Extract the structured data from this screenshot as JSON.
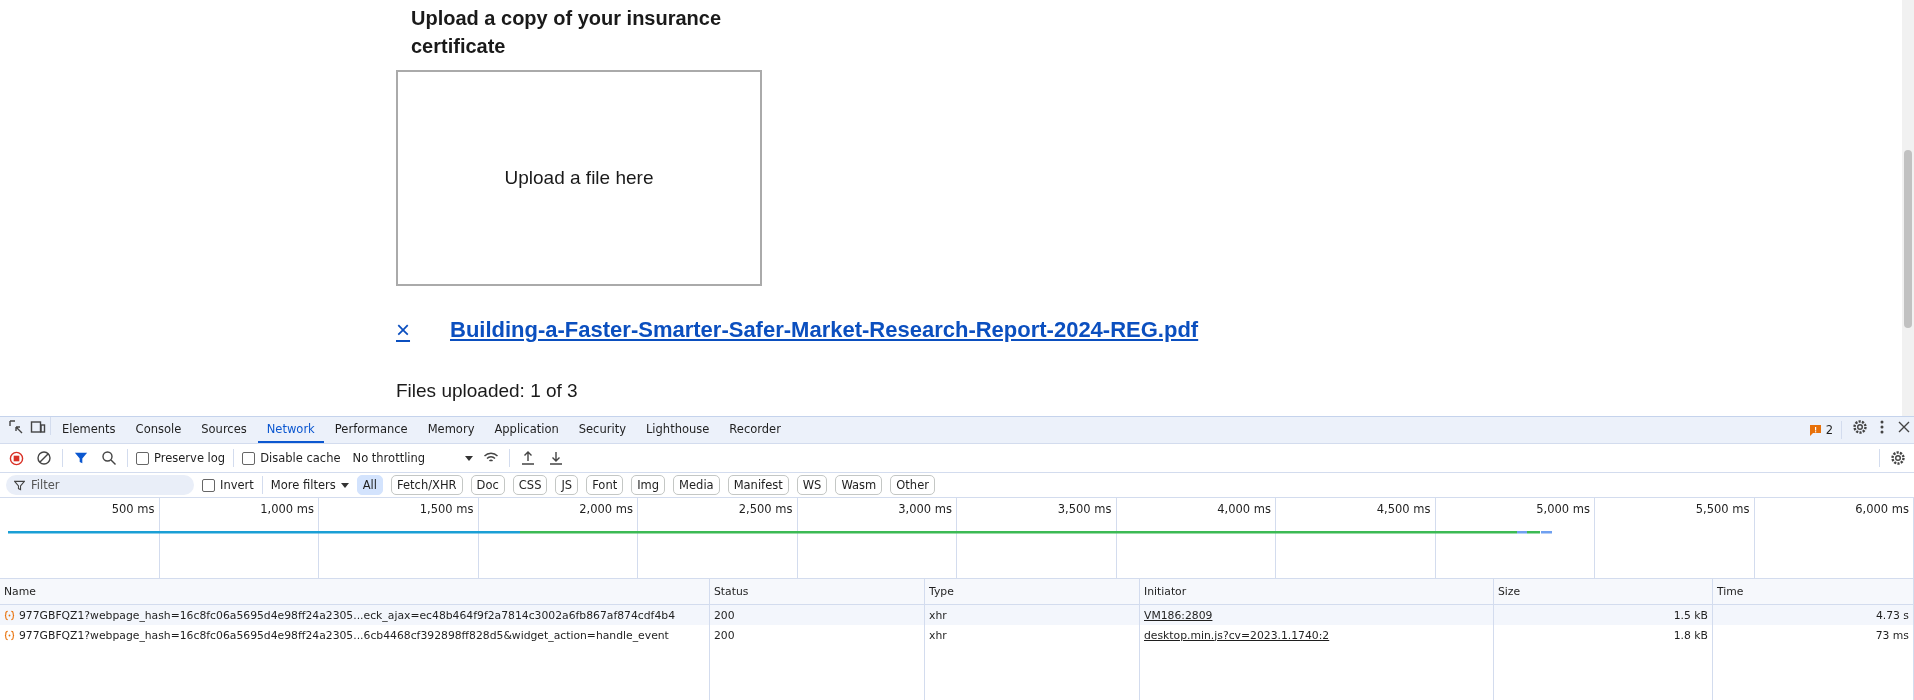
{
  "page": {
    "heading": "Upload a copy of your insurance certificate",
    "dropzone": "Upload a file here",
    "remove_symbol": "×",
    "file_link": "Building-a-Faster-Smarter-Safer-Market-Research-Report-2024-REG.pdf",
    "status": "Files uploaded: 1 of 3"
  },
  "devtools": {
    "tabs": [
      {
        "label": "Elements",
        "selected": false
      },
      {
        "label": "Console",
        "selected": false
      },
      {
        "label": "Sources",
        "selected": false
      },
      {
        "label": "Network",
        "selected": true
      },
      {
        "label": "Performance",
        "selected": false
      },
      {
        "label": "Memory",
        "selected": false
      },
      {
        "label": "Application",
        "selected": false
      },
      {
        "label": "Security",
        "selected": false
      },
      {
        "label": "Lighthouse",
        "selected": false
      },
      {
        "label": "Recorder",
        "selected": false
      }
    ],
    "issues_count": "2",
    "toolbar": {
      "preserve_log": {
        "label": "Preserve log",
        "checked": false
      },
      "disable_cache": {
        "label": "Disable cache",
        "checked": false
      },
      "throttling": "No throttling"
    },
    "filter": {
      "placeholder": "Filter",
      "invert": {
        "label": "Invert",
        "checked": false
      },
      "more_filters": "More filters",
      "types": [
        {
          "label": "All",
          "selected": true
        },
        {
          "label": "Fetch/XHR",
          "selected": false
        },
        {
          "label": "Doc",
          "selected": false
        },
        {
          "label": "CSS",
          "selected": false
        },
        {
          "label": "JS",
          "selected": false
        },
        {
          "label": "Font",
          "selected": false
        },
        {
          "label": "Img",
          "selected": false
        },
        {
          "label": "Media",
          "selected": false
        },
        {
          "label": "Manifest",
          "selected": false
        },
        {
          "label": "WS",
          "selected": false
        },
        {
          "label": "Wasm",
          "selected": false
        },
        {
          "label": "Other",
          "selected": false
        }
      ]
    },
    "timeline_ticks": [
      "500 ms",
      "1,000 ms",
      "1,500 ms",
      "2,000 ms",
      "2,500 ms",
      "3,000 ms",
      "3,500 ms",
      "4,000 ms",
      "4,500 ms",
      "5,000 ms",
      "5,500 ms",
      "6,000 ms"
    ],
    "table": {
      "columns": [
        "Name",
        "Status",
        "Type",
        "Initiator",
        "Size",
        "Time"
      ],
      "rows": [
        {
          "name": "977GBFQZ1?webpage_hash=16c8fc06a5695d4e98ff24a2305...eck_ajax=ec48b464f9f2a7814c3002a6fb867af874cdf4b4",
          "status": "200",
          "type": "xhr",
          "initiator": "VM186:2809",
          "size": "1.5 kB",
          "time": "4.73 s",
          "selected": true
        },
        {
          "name": "977GBFQZ1?webpage_hash=16c8fc06a5695d4e98ff24a2305...6cb4468cf392898ff828d5&widget_action=handle_event",
          "status": "200",
          "type": "xhr",
          "initiator": "desktop.min.js?cv=2023.1.1740:2",
          "size": "1.8 kB",
          "time": "73 ms",
          "selected": false
        }
      ]
    }
  }
}
